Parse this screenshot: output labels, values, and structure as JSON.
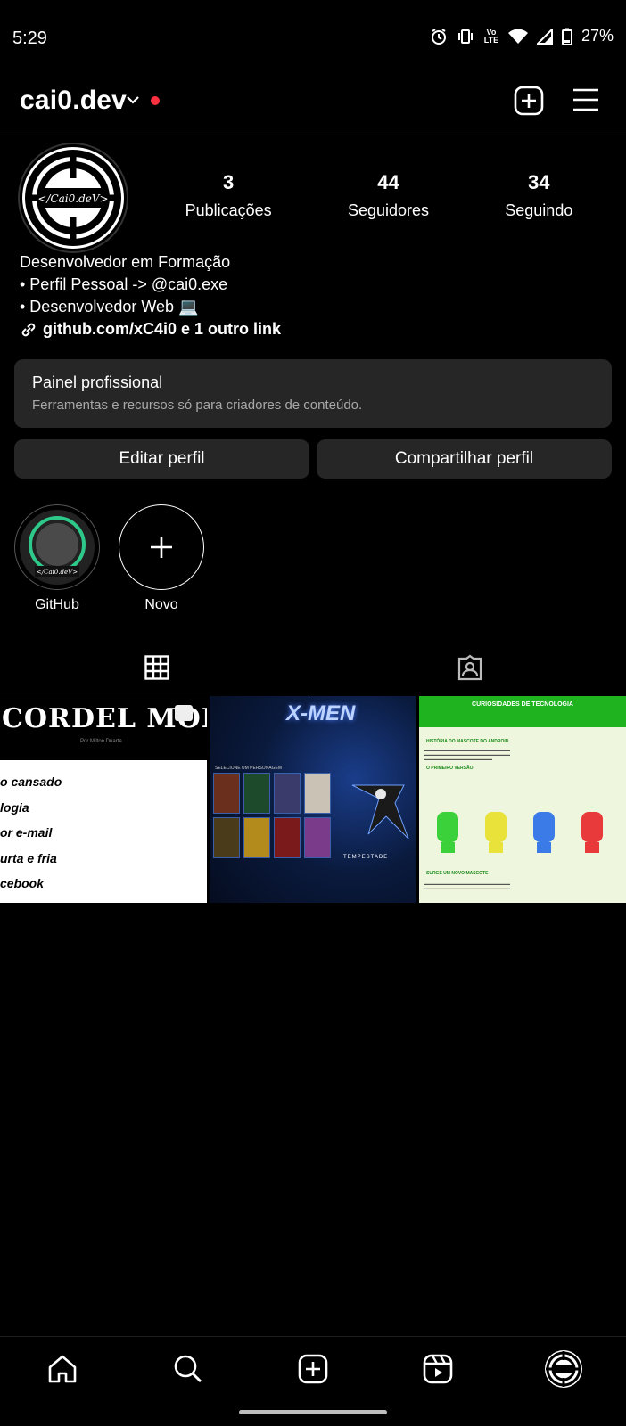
{
  "status": {
    "time": "5:29",
    "battery": "27%",
    "volte_label": "Vo LTE"
  },
  "header": {
    "username": "cai0.dev",
    "has_notification_dot": true
  },
  "profile": {
    "avatar_text": "</Cai0.deV>",
    "stats": [
      {
        "value": "3",
        "label": "Publicações"
      },
      {
        "value": "44",
        "label": "Seguidores"
      },
      {
        "value": "34",
        "label": "Seguindo"
      }
    ],
    "bio": {
      "line1": "Desenvolvedor em Formação",
      "line2": "• Perfil Pessoal -> @cai0.exe",
      "line3": " • Desenvolvedor Web 💻",
      "link": "github.com/xC4i0 e 1 outro link"
    }
  },
  "pro_panel": {
    "title": "Painel profissional",
    "subtitle": "Ferramentas e recursos só para criadores de conteúdo."
  },
  "buttons": {
    "edit": "Editar perfil",
    "share": "Compartilhar perfil"
  },
  "highlights": [
    {
      "label": "GitHub",
      "inner_text": "</Cai0.deV>"
    },
    {
      "label": "Novo"
    }
  ],
  "posts": {
    "post1": {
      "title": "CORDEL MODERNO",
      "byline": "Por Milton Duarte",
      "lines": [
        "o cansado",
        "logia",
        "or e-mail",
        "urta e fria",
        "cebook"
      ]
    },
    "post2": {
      "logo": "X-MEN",
      "caption": "SELECIONE UM PERSONAGEM",
      "name": "TEMPESTADE"
    },
    "post3": {
      "title": "CURIOSIDADES DE TECNOLOGIA",
      "heading1": "HISTÓRIA DO MASCOTE DO ANDROID",
      "heading2": "O PRIMEIRO VERSÃO",
      "heading3": "SURGE UM NOVO MASCOTE"
    }
  },
  "colors": {
    "background": "#000000",
    "panel": "#262626",
    "notification": "#ff3040",
    "muted_text": "#a8a8a8"
  }
}
